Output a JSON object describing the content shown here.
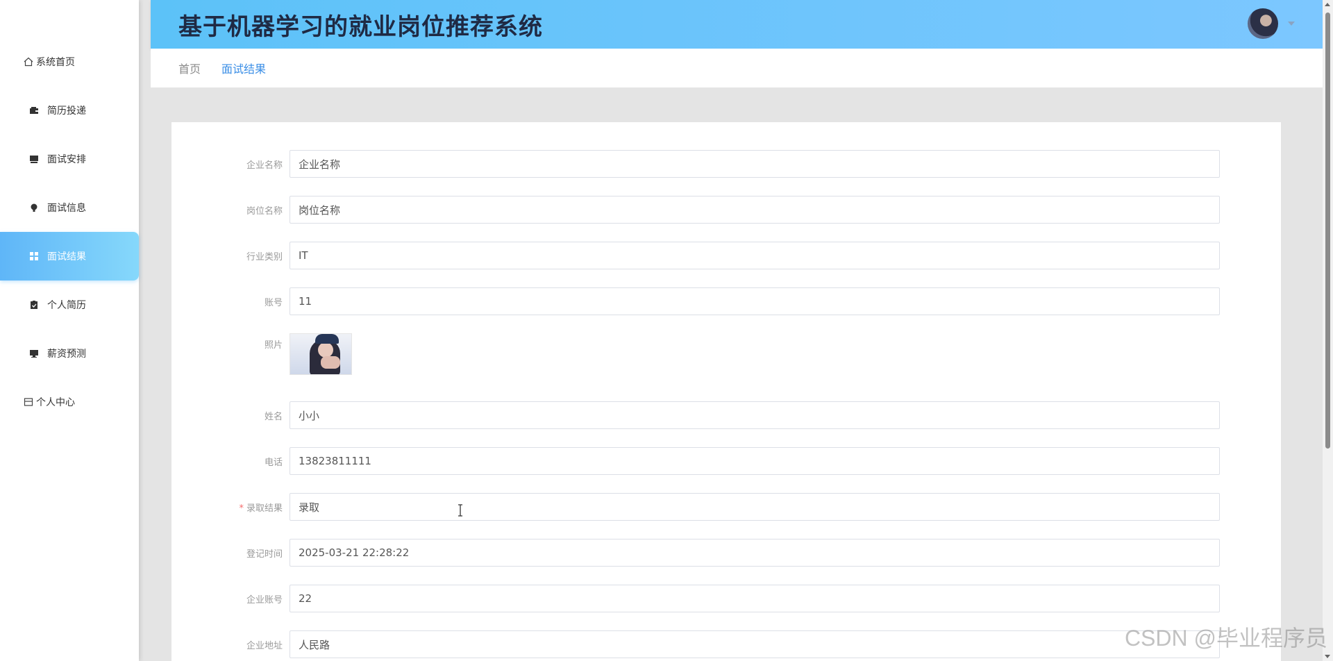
{
  "app": {
    "title": "基于机器学习的就业岗位推荐系统"
  },
  "sidebar": {
    "items": [
      {
        "label": "系统首页",
        "icon": "home-icon"
      },
      {
        "label": "简历投递",
        "icon": "wallet-icon"
      },
      {
        "label": "面试安排",
        "icon": "monitor-icon"
      },
      {
        "label": "面试信息",
        "icon": "bulb-icon"
      },
      {
        "label": "面试结果",
        "icon": "grid-icon",
        "active": true
      },
      {
        "label": "个人简历",
        "icon": "clipboard-icon"
      },
      {
        "label": "薪资预测",
        "icon": "desktop-icon"
      },
      {
        "label": "个人中心",
        "icon": "panel-icon"
      }
    ]
  },
  "breadcrumb": {
    "home": "首页",
    "current": "面试结果"
  },
  "form": {
    "company_name": {
      "label": "企业名称",
      "value": "企业名称"
    },
    "job_name": {
      "label": "岗位名称",
      "value": "岗位名称"
    },
    "industry": {
      "label": "行业类别",
      "value": "IT"
    },
    "account": {
      "label": "账号",
      "value": "11"
    },
    "photo": {
      "label": "照片"
    },
    "name": {
      "label": "姓名",
      "value": "小小"
    },
    "phone": {
      "label": "电话",
      "value": "13823811111"
    },
    "result": {
      "label": "录取结果",
      "value": "录取",
      "required_mark": "*"
    },
    "reg_time": {
      "label": "登记时间",
      "value": "2025-03-21 22:28:22"
    },
    "company_account": {
      "label": "企业账号",
      "value": "22"
    },
    "company_address": {
      "label": "企业地址",
      "value": "人民路"
    }
  },
  "watermark": "CSDN @毕业程序员",
  "colors": {
    "accent": "#5fb6f8",
    "header_start": "#5cc2f8",
    "header_end": "#7cc7ff",
    "link": "#3a8ee6"
  }
}
